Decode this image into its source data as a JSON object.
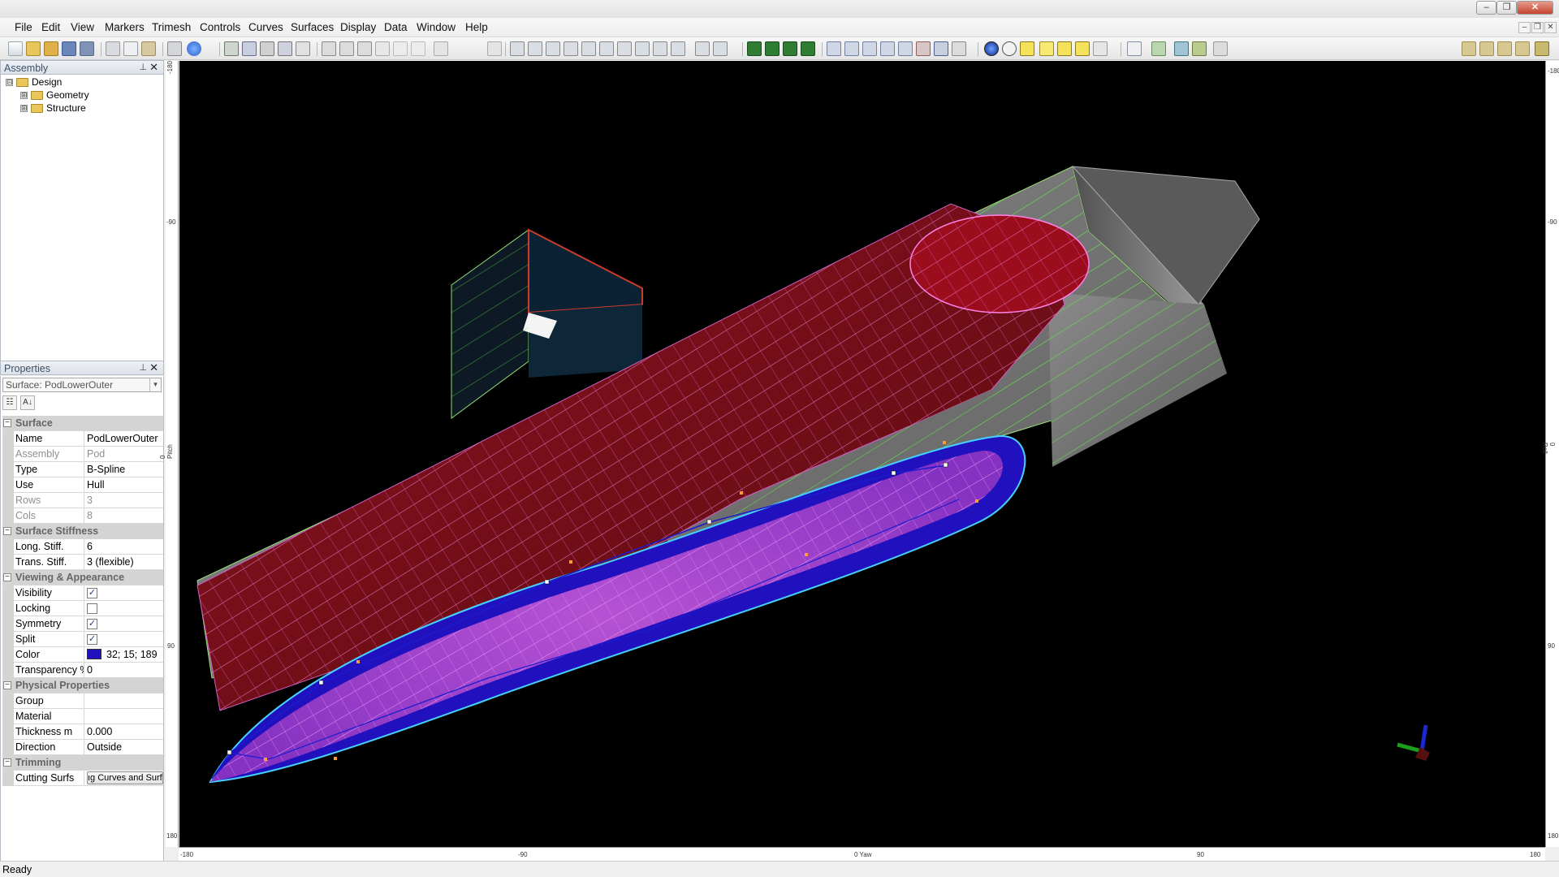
{
  "menu": [
    "File",
    "Edit",
    "View",
    "Markers",
    "Trimesh",
    "Controls",
    "Curves",
    "Surfaces",
    "Display",
    "Data",
    "Window",
    "Help"
  ],
  "assembly_panel": {
    "title": "Assembly",
    "tree": [
      {
        "label": "Design",
        "expander": "⊟"
      },
      {
        "label": "Geometry",
        "expander": "⊞"
      },
      {
        "label": "Structure",
        "expander": "⊞"
      }
    ]
  },
  "properties_panel": {
    "title": "Properties",
    "selector": "Surface: PodLowerOuter",
    "categories": [
      {
        "title": "Surface",
        "rows": [
          {
            "name": "Name",
            "value": "PodLowerOuter"
          },
          {
            "name": "Assembly",
            "value": "Pod",
            "dim": true
          },
          {
            "name": "Type",
            "value": "B-Spline"
          },
          {
            "name": "Use",
            "value": "Hull"
          },
          {
            "name": "Rows",
            "value": "3",
            "dim": true
          },
          {
            "name": "Cols",
            "value": "8",
            "dim": true
          }
        ]
      },
      {
        "title": "Surface Stiffness",
        "rows": [
          {
            "name": "Long. Stiff.",
            "value": "6"
          },
          {
            "name": "Trans. Stiff.",
            "value": "3 (flexible)"
          }
        ]
      },
      {
        "title": "Viewing & Appearance",
        "rows": [
          {
            "name": "Visibility",
            "checked": true
          },
          {
            "name": "Locking",
            "checked": false
          },
          {
            "name": "Symmetry",
            "checked": true
          },
          {
            "name": "Split",
            "checked": true
          },
          {
            "name": "Color",
            "value": "32; 15; 189",
            "swatch": "#2010bd"
          },
          {
            "name": "Transparency %",
            "value": "0"
          }
        ]
      },
      {
        "title": "Physical Properties",
        "rows": [
          {
            "name": "Group",
            "value": ""
          },
          {
            "name": "Material",
            "value": ""
          },
          {
            "name": "Thickness m",
            "value": "0.000"
          },
          {
            "name": "Direction",
            "value": "Outside"
          }
        ]
      },
      {
        "title": "Trimming",
        "rows": [
          {
            "name": "Cutting Surfs",
            "button": "ıg Curves and Surfa"
          }
        ]
      }
    ]
  },
  "viewport": {
    "left_ruler": [
      "-180",
      "-90",
      "0 Pitch",
      "90",
      "180"
    ],
    "right_ruler": [
      "-180",
      "-90",
      "0 Roll",
      "90",
      "180"
    ],
    "bottom_ruler": [
      "-180",
      "-90",
      "0 Yaw",
      "90",
      "180"
    ]
  },
  "status": "Ready",
  "colors": {
    "background": "#000000",
    "hull_outer": "#7f7f7f",
    "hull_inner": "#6e0b12",
    "pod": "#2010bd",
    "pod_overlay": "#b040d0",
    "stations": "#60e040",
    "buttocks": "#ff70ff"
  }
}
